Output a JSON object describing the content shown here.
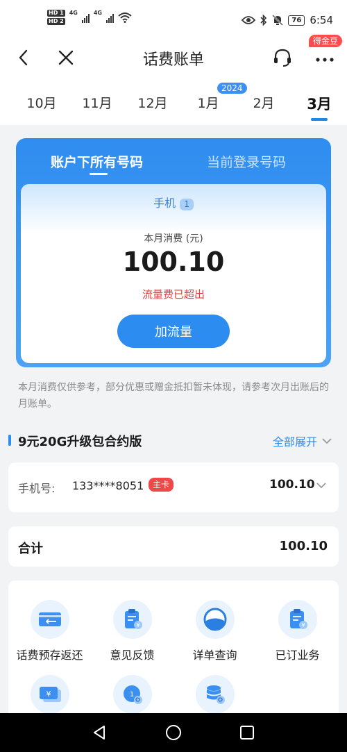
{
  "status_bar": {
    "hd1": "HD 1",
    "hd2": "HD 2",
    "net1": "4G",
    "net2": "4G",
    "battery": "76",
    "time": "6:54"
  },
  "nav": {
    "title": "话费账单",
    "reward_badge": "得金豆",
    "icons": [
      "back-icon",
      "close-icon",
      "headset-icon",
      "more-icon"
    ]
  },
  "month_tabs": {
    "year_badge": "2024",
    "tabs": [
      "10月",
      "11月",
      "12月",
      "1月",
      "2月",
      "3月"
    ],
    "active": "3月"
  },
  "account": {
    "tab_all": "账户下所有号码",
    "tab_current": "当前登录号码",
    "phone_label": "手机",
    "phone_count": "1",
    "usage_label": "本月消费 (元)",
    "usage_amount": "100.10",
    "warning": "流量费已超出",
    "add_data_button": "加流量"
  },
  "notice": "本月消费仅供参考，部分优惠或赠金抵扣暂未体现，请参考次月出账后的月账单。",
  "package": {
    "title": "9元20G升级包合约版",
    "expand_all": "全部展开"
  },
  "phone_row": {
    "label": "手机号:",
    "number": "133****8051",
    "badge": "主卡",
    "amount": "100.10"
  },
  "total": {
    "label": "合计",
    "amount": "100.10"
  },
  "services": [
    {
      "label": "话费预存返还",
      "icon": "card-return-icon"
    },
    {
      "label": "意见反馈",
      "icon": "feedback-clipboard-icon"
    },
    {
      "label": "详单查询",
      "icon": "detail-query-icon"
    },
    {
      "label": "已订业务",
      "icon": "subscribed-clipboard-icon"
    },
    {
      "label": "",
      "icon": "yen-card-icon"
    },
    {
      "label": "",
      "icon": "data-search-icon"
    },
    {
      "label": "",
      "icon": "database-search-icon"
    }
  ],
  "colors": {
    "accent": "#2d8cf0",
    "warning": "#e23d3d",
    "badge_red": "#f04848"
  }
}
